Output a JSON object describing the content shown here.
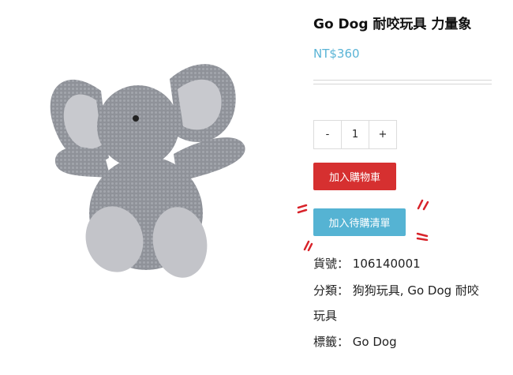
{
  "product": {
    "title": "Go Dog 耐咬玩具 力量象",
    "price": "NT$360",
    "image_icon": "plush-elephant-image"
  },
  "quantity": {
    "minus": "-",
    "value": "1",
    "plus": "+"
  },
  "buttons": {
    "add_to_cart": "加入購物車",
    "add_to_wishlist": "加入待購清單"
  },
  "meta": {
    "sku_label": "貨號：",
    "sku_value": "106140001",
    "category_label": "分類：",
    "categories_line1": "狗狗玩具, Go Dog 耐咬",
    "categories_line2": "玩具",
    "tag_label": "標籤：",
    "tag_value": "Go Dog"
  },
  "colors": {
    "price": "#5ab4d6",
    "cart_button": "#d63030",
    "wishlist_button": "#55b3d3",
    "highlight": "#d8232a"
  }
}
